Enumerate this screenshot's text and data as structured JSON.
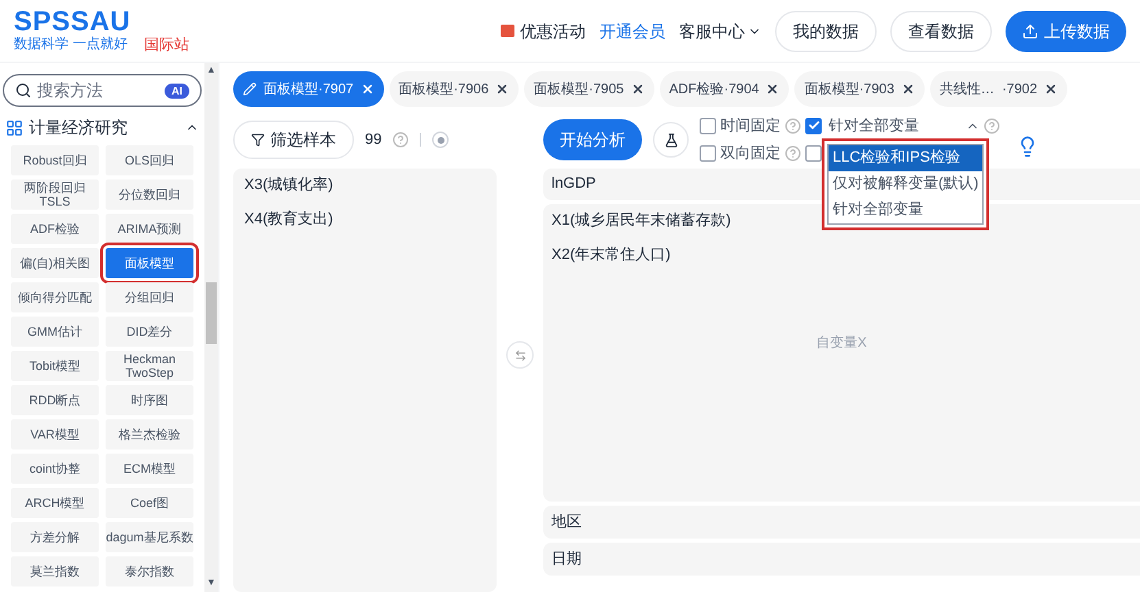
{
  "brand": {
    "name": "SPSSAU",
    "slogan": "数据科学 一点就好",
    "site": "国际站"
  },
  "nav": [
    {
      "kind": "promo",
      "label": "优惠活动"
    },
    {
      "kind": "link",
      "label": "开通会员"
    },
    {
      "kind": "menu",
      "label": "客服中心"
    },
    {
      "kind": "outline",
      "label": "我的数据"
    },
    {
      "kind": "outline",
      "label": "查看数据"
    },
    {
      "kind": "primary",
      "label": "上传数据"
    }
  ],
  "sidebar": {
    "search": {
      "placeholder": "搜索方法",
      "badge": "AI"
    },
    "section": {
      "title": "计量经济研究",
      "expanded": true
    },
    "scroll": {
      "up": "▲",
      "down": "▼"
    },
    "items": [
      {
        "label": "Robust回归",
        "selected": false,
        "highlighted": false
      },
      {
        "label": "OLS回归",
        "selected": false,
        "highlighted": false
      },
      {
        "label": "两阶段回归 TSLS",
        "selected": false,
        "highlighted": false
      },
      {
        "label": "分位数回归",
        "selected": false,
        "highlighted": false
      },
      {
        "label": "ADF检验",
        "selected": false,
        "highlighted": false
      },
      {
        "label": "ARIMA预测",
        "selected": false,
        "highlighted": false
      },
      {
        "label": "偏(自)相关图",
        "selected": false,
        "highlighted": false
      },
      {
        "label": "面板模型",
        "selected": true,
        "highlighted": true
      },
      {
        "label": "倾向得分匹配",
        "selected": false,
        "highlighted": false
      },
      {
        "label": "分组回归",
        "selected": false,
        "highlighted": false
      },
      {
        "label": "GMM估计",
        "selected": false,
        "highlighted": false
      },
      {
        "label": "DID差分",
        "selected": false,
        "highlighted": false
      },
      {
        "label": "Tobit模型",
        "selected": false,
        "highlighted": false
      },
      {
        "label": "Heckman TwoStep",
        "selected": false,
        "highlighted": false
      },
      {
        "label": "RDD断点",
        "selected": false,
        "highlighted": false
      },
      {
        "label": "时序图",
        "selected": false,
        "highlighted": false
      },
      {
        "label": "VAR模型",
        "selected": false,
        "highlighted": false
      },
      {
        "label": "格兰杰检验",
        "selected": false,
        "highlighted": false
      },
      {
        "label": "coint协整",
        "selected": false,
        "highlighted": false
      },
      {
        "label": "ECM模型",
        "selected": false,
        "highlighted": false
      },
      {
        "label": "ARCH模型",
        "selected": false,
        "highlighted": false
      },
      {
        "label": "Coef图",
        "selected": false,
        "highlighted": false
      },
      {
        "label": "方差分解",
        "selected": false,
        "highlighted": false
      },
      {
        "label": "dagum基尼系数",
        "selected": false,
        "highlighted": false
      },
      {
        "label": "莫兰指数",
        "selected": false,
        "highlighted": false
      },
      {
        "label": "泰尔指数",
        "selected": false,
        "highlighted": false
      }
    ]
  },
  "tabs": [
    {
      "label": "面板模型·7907",
      "selected": true
    },
    {
      "label": "面板模型·7906",
      "selected": false
    },
    {
      "label": "面板模型·7905",
      "selected": false
    },
    {
      "label": "ADF检验·7904",
      "selected": false
    },
    {
      "label": "面板模型·7903",
      "selected": false
    },
    {
      "label": "共线性…  ·7902",
      "selected": false
    }
  ],
  "filter": {
    "label": "筛选样本",
    "count": "99"
  },
  "variables": [
    "X3(城镇化率)",
    "X4(教育支出)"
  ],
  "toolbar": {
    "start": "开始分析",
    "options": [
      {
        "label": "时间固定",
        "checked": false
      },
      {
        "label": "双向固定",
        "checked": false
      }
    ],
    "extra_checks": [
      {
        "checked": true
      },
      {
        "checked": false
      }
    ],
    "select": {
      "value": "针对全部变量",
      "expanded": true,
      "highlighted": true,
      "options": [
        {
          "label": "LLC检验和IPS检验",
          "hovered": true
        },
        {
          "label": "仅对被解释变量(默认)",
          "hovered": false
        },
        {
          "label": "针对全部变量",
          "hovered": false
        }
      ]
    }
  },
  "dependent": "lnGDP",
  "independent": {
    "items": [
      "X1(城乡居民年末储蓄存款)",
      "X2(年末常住人口)"
    ],
    "hint": "自变量X"
  },
  "region": "地区",
  "date": "日期"
}
